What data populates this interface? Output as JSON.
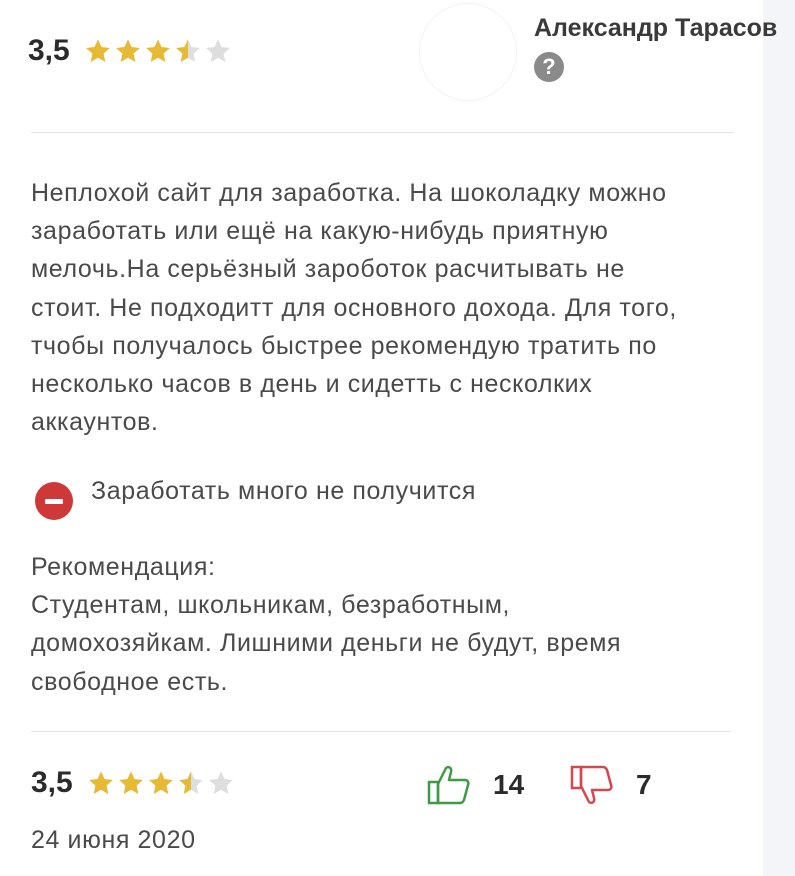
{
  "header": {
    "rating": "3,5",
    "stars": {
      "filled": 3,
      "half": 1,
      "empty": 1,
      "value": 3.5,
      "max": 5
    },
    "author_name": "Александр Тарасов",
    "author_badge": "?"
  },
  "review": {
    "text": "Неплохой сайт для заработка. На шоколадку можно\nзаработать или ещё на какую-нибудь приятную\nмелочь.На серьёзный зароботок расчитывать не\nстоит. Не подходитт для основного дохода. Для того,\nтчобы получалось быстрее рекомендую тратить по\nнесколько часов в день и сидетть с несколких\nаккаунтов.",
    "con": "Заработать много не получится",
    "recommendation": "Рекомендация:\nСтудентам, школьникам, безработным,\nдомохозяйкам. Лишними деньги не будут, время\nсвободное есть."
  },
  "footer": {
    "rating": "3,5",
    "stars": {
      "value": 3.5,
      "max": 5
    },
    "likes": "14",
    "dislikes": "7",
    "date": "24 июня 2020"
  },
  "colors": {
    "star": "#e8b935",
    "star_empty": "#dedede",
    "like": "#3f9a45",
    "dislike": "#d6474d",
    "con_icon": "#cf3838"
  },
  "icons": {
    "star": "star-icon",
    "con": "minus-circle-icon",
    "like": "thumbs-up-icon",
    "dislike": "thumbs-down-icon"
  }
}
